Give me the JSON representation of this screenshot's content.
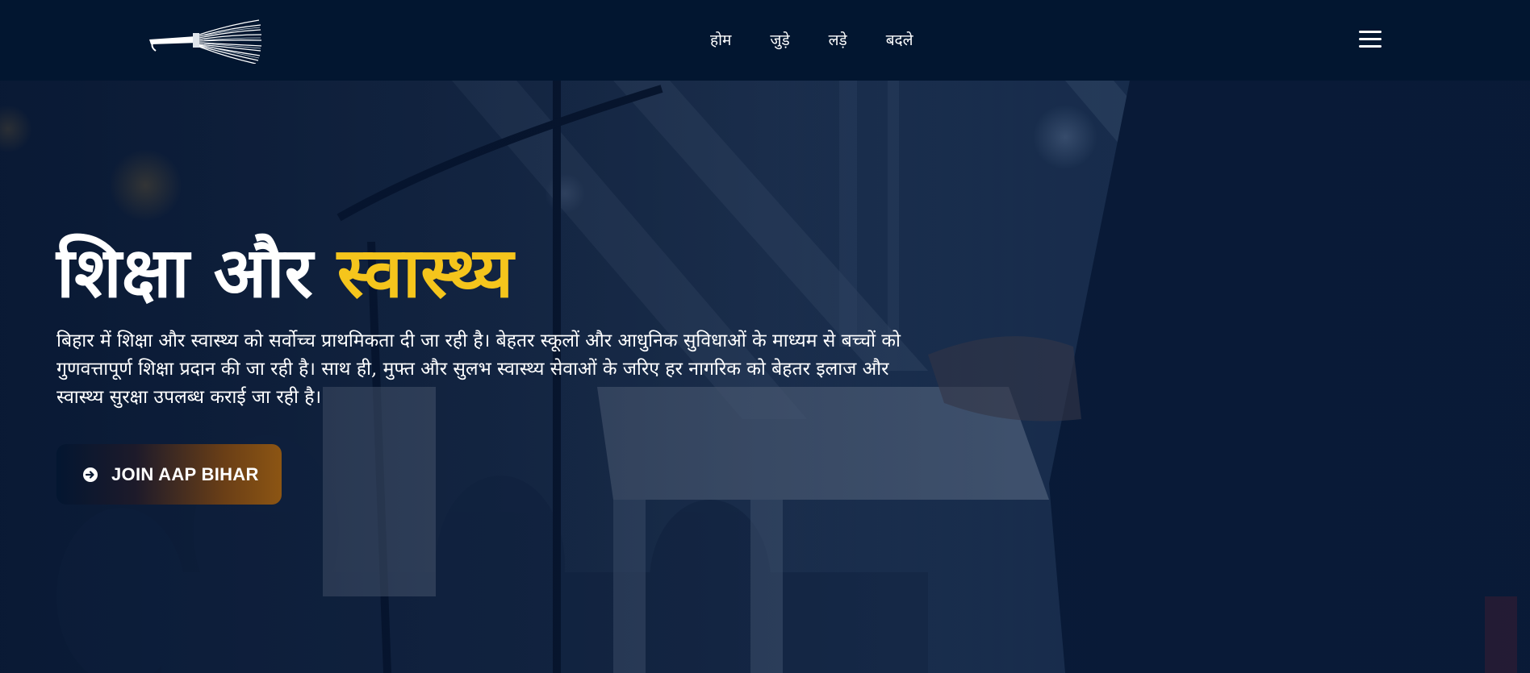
{
  "header": {
    "logo": {
      "icon": "broom-icon"
    },
    "nav": [
      {
        "label": "होम"
      },
      {
        "label": "जुड़े"
      },
      {
        "label": "लड़े"
      },
      {
        "label": "बदले"
      }
    ],
    "menu_icon": "hamburger-menu-icon"
  },
  "hero": {
    "title_part1": "शिक्षा और",
    "title_highlight": "स्वास्थ्य",
    "description": "बिहार में शिक्षा और स्वास्थ्य को सर्वोच्च प्राथमिकता दी जा रही है। बेहतर स्कूलों और आधुनिक सुविधाओं के माध्यम से बच्चों को गुणवत्तापूर्ण शिक्षा प्रदान की जा रही है। साथ ही, मुफ्त और सुलभ स्वास्थ्य सेवाओं के जरिए हर नागरिक को बेहतर इलाज और स्वास्थ्य सुरक्षा उपलब्ध कराई जा रही है।",
    "cta": {
      "label": "JOIN AAP BIHAR",
      "icon": "arrow-circle-right-icon"
    },
    "background": "speaker-at-podium-image"
  },
  "colors": {
    "header_bg": "#021630",
    "highlight": "#f5c51c",
    "cta_gradient_end": "#8c5513"
  }
}
